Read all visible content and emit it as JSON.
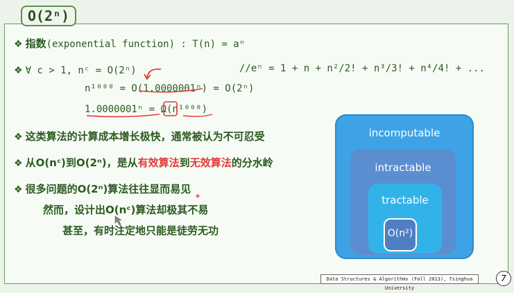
{
  "slide": {
    "title": "O(2ⁿ)",
    "bullets": {
      "b1_prefix": "指数",
      "b1_formula": "(exponential  function) : T(n)  =  aⁿ",
      "b2_formula": "∀ c > 1,  nᶜ = O(2ⁿ)",
      "b2_comment": "//eⁿ = 1 + n + n²/2! + n³/3! + n⁴/4! + ...",
      "eq1": "n¹⁰⁰⁰ = O(1.0000001ⁿ) = O(2ⁿ)",
      "eq2_a": "1.0000001ⁿ = ",
      "eq2_omega": "Ω",
      "eq2_b": "(n¹⁰⁰⁰)",
      "b3": "这类算法的计算成本增长极快，通常被认为不可忍受",
      "b4_p1": "从O(nᶜ)到O(2ⁿ)，是从",
      "b4_p2": "有效算法",
      "b4_p3": "到",
      "b4_p4": "无效算法",
      "b4_p5": "的分水岭",
      "b5": "很多问题的O(2ⁿ)算法往往显而易见",
      "b5_sub1": "然而，设计出O(nᶜ)算法却极其不易",
      "b5_sub2": "甚至，有时注定地只能是徒劳无功"
    }
  },
  "diagram": {
    "outer_label": "incomputable",
    "middle_label": "intractable",
    "inner_label": "tractable",
    "core_label": "O(n²)"
  },
  "footer": {
    "course": "Data Structures & Algorithms (Fall 2013), Tsinghua University",
    "page": "7"
  },
  "colors": {
    "text_green": "#2a5a1f",
    "highlight_red": "#e53935",
    "incomputable": "#3ea3e6",
    "intractable": "#5b8ed0",
    "tractable": "#31b3ea",
    "core": "#4f7ec2"
  }
}
